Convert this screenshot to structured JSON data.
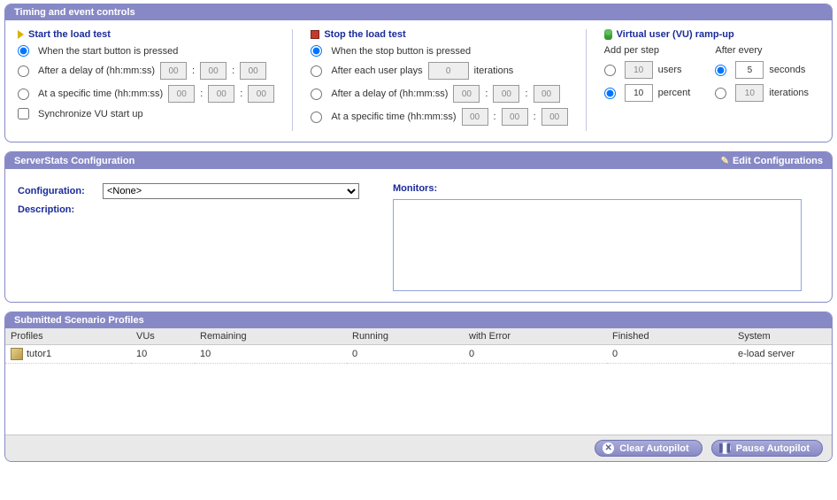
{
  "timing": {
    "panel_title": "Timing and event controls",
    "start": {
      "title": "Start the load test",
      "opt_press": "When the start button is pressed",
      "opt_delay": "After a delay of (hh:mm:ss)",
      "opt_time": "At a specific time (hh:mm:ss)",
      "sync": "Synchronize VU start up",
      "delay": {
        "h": "00",
        "m": "00",
        "s": "00"
      },
      "time": {
        "h": "00",
        "m": "00",
        "s": "00"
      }
    },
    "stop": {
      "title": "Stop the load test",
      "opt_press": "When the stop button is pressed",
      "opt_iter": "After each user plays",
      "iter_suffix": "iterations",
      "iter_val": "0",
      "opt_delay": "After a delay of (hh:mm:ss)",
      "opt_time": "At a specific time (hh:mm:ss)",
      "delay": {
        "h": "00",
        "m": "00",
        "s": "00"
      },
      "time": {
        "h": "00",
        "m": "00",
        "s": "00"
      }
    },
    "ramp": {
      "title": "Virtual user (VU) ramp-up",
      "add_label": "Add per step",
      "after_label": "After every",
      "users_val": "10",
      "users_unit": "users",
      "percent_val": "10",
      "percent_unit": "percent",
      "seconds_val": "5",
      "seconds_unit": "seconds",
      "iter_val": "10",
      "iter_unit": "iterations"
    }
  },
  "serverstats": {
    "panel_title": "ServerStats Configuration",
    "edit": "Edit Configurations",
    "config_label": "Configuration:",
    "config_value": "<None>",
    "desc_label": "Description:",
    "mon_label": "Monitors:"
  },
  "profiles": {
    "panel_title": "Submitted Scenario Profiles",
    "headers": {
      "profiles": "Profiles",
      "vus": "VUs",
      "remaining": "Remaining",
      "running": "Running",
      "error": "with Error",
      "finished": "Finished",
      "system": "System"
    },
    "rows": [
      {
        "name": "tutor1",
        "vus": "10",
        "remaining": "10",
        "running": "0",
        "error": "0",
        "finished": "0",
        "system": "e-load server"
      }
    ]
  },
  "footer": {
    "clear": "Clear Autopilot",
    "pause": "Pause Autopilot"
  }
}
